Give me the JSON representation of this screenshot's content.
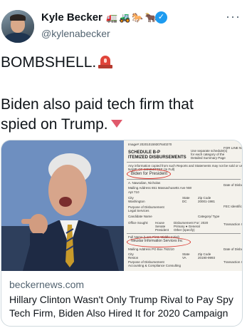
{
  "tweet": {
    "author_name": "Kyle Becker",
    "author_handle": "@kylenabecker",
    "name_emojis": [
      "🚛",
      "🚜",
      "🐎",
      "🐂"
    ],
    "more_label": "···",
    "text_line1": "BOMBSHELL.",
    "text_line2": "Biden also paid tech firm that spied on Trump."
  },
  "card": {
    "domain": "beckernews.com",
    "headline": "Hillary Clinton Wasn't Only Trump Rival to Pay Spy Tech Firm, Biden Also Hired It for 2020 Campaign",
    "document": {
      "schedule_label": "SCHEDULE B-P",
      "schedule_sub": "ITEMIZED DISBURSEMENTS",
      "committee": "Biden for President",
      "payee": "Neustar Information Services Inc"
    }
  },
  "colors": {
    "verified": "#1d9bf0",
    "secondary_text": "#536471",
    "annotation_red": "#d8332b"
  }
}
